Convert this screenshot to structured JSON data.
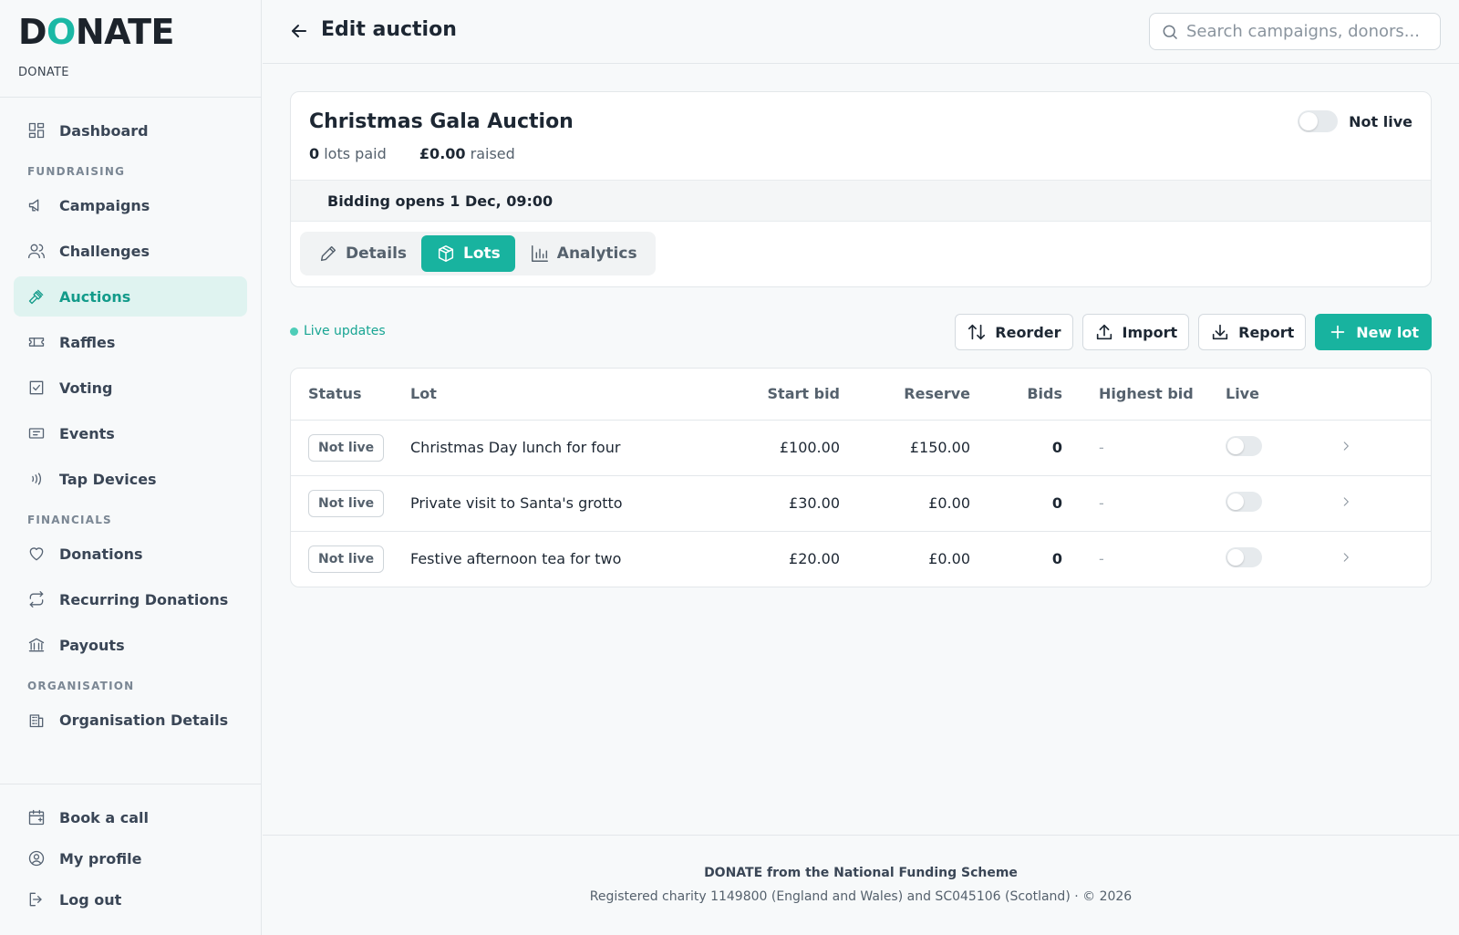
{
  "brand": {
    "logo_left": "D",
    "logo_o": "O",
    "logo_right": "NATE",
    "subtitle": "DONATE"
  },
  "sidebar": {
    "dashboard": "Dashboard",
    "sections": {
      "fundraising": "FUNDRAISING",
      "financials": "FINANCIALS",
      "organisation": "ORGANISATION"
    },
    "items": {
      "campaigns": "Campaigns",
      "challenges": "Challenges",
      "auctions": "Auctions",
      "raffles": "Raffles",
      "voting": "Voting",
      "events": "Events",
      "tap_devices": "Tap Devices",
      "donations": "Donations",
      "recurring_donations": "Recurring Donations",
      "payouts": "Payouts",
      "organisation_details": "Organisation Details"
    },
    "bottom": {
      "book_call": "Book a call",
      "my_profile": "My profile",
      "log_out": "Log out"
    }
  },
  "header": {
    "title": "Edit auction",
    "search_placeholder": "Search campaigns, donors..."
  },
  "auction": {
    "title": "Christmas Gala Auction",
    "lots_paid_value": "0",
    "lots_paid_label": "lots paid",
    "raised_value": "£0.00",
    "raised_label": "raised",
    "live_status": "Not live",
    "bidding_opens": "Bidding opens 1 Dec, 09:00",
    "tabs": {
      "details": "Details",
      "lots": "Lots",
      "analytics": "Analytics"
    }
  },
  "toolbar": {
    "live_updates": "Live updates",
    "reorder": "Reorder",
    "import": "Import",
    "report": "Report",
    "new_lot": "New lot"
  },
  "table": {
    "headers": {
      "status": "Status",
      "lot": "Lot",
      "start_bid": "Start bid",
      "reserve": "Reserve",
      "bids": "Bids",
      "highest_bid": "Highest bid",
      "live": "Live"
    },
    "rows": [
      {
        "status": "Not live",
        "lot": "Christmas Day lunch for four",
        "start_bid": "£100.00",
        "reserve": "£150.00",
        "bids": "0",
        "highest_bid": "-"
      },
      {
        "status": "Not live",
        "lot": "Private visit to Santa's grotto",
        "start_bid": "£30.00",
        "reserve": "£0.00",
        "bids": "0",
        "highest_bid": "-"
      },
      {
        "status": "Not live",
        "lot": "Festive afternoon tea for two",
        "start_bid": "£20.00",
        "reserve": "£0.00",
        "bids": "0",
        "highest_bid": "-"
      }
    ]
  },
  "footer": {
    "line1": "DONATE from the National Funding Scheme",
    "line2": "Registered charity 1149800 (England and Wales) and SC045106 (Scotland)  ·  © 2026"
  },
  "colors": {
    "accent": "#18b39f",
    "active_nav_bg": "#dff3f0",
    "text": "#1d2733"
  }
}
